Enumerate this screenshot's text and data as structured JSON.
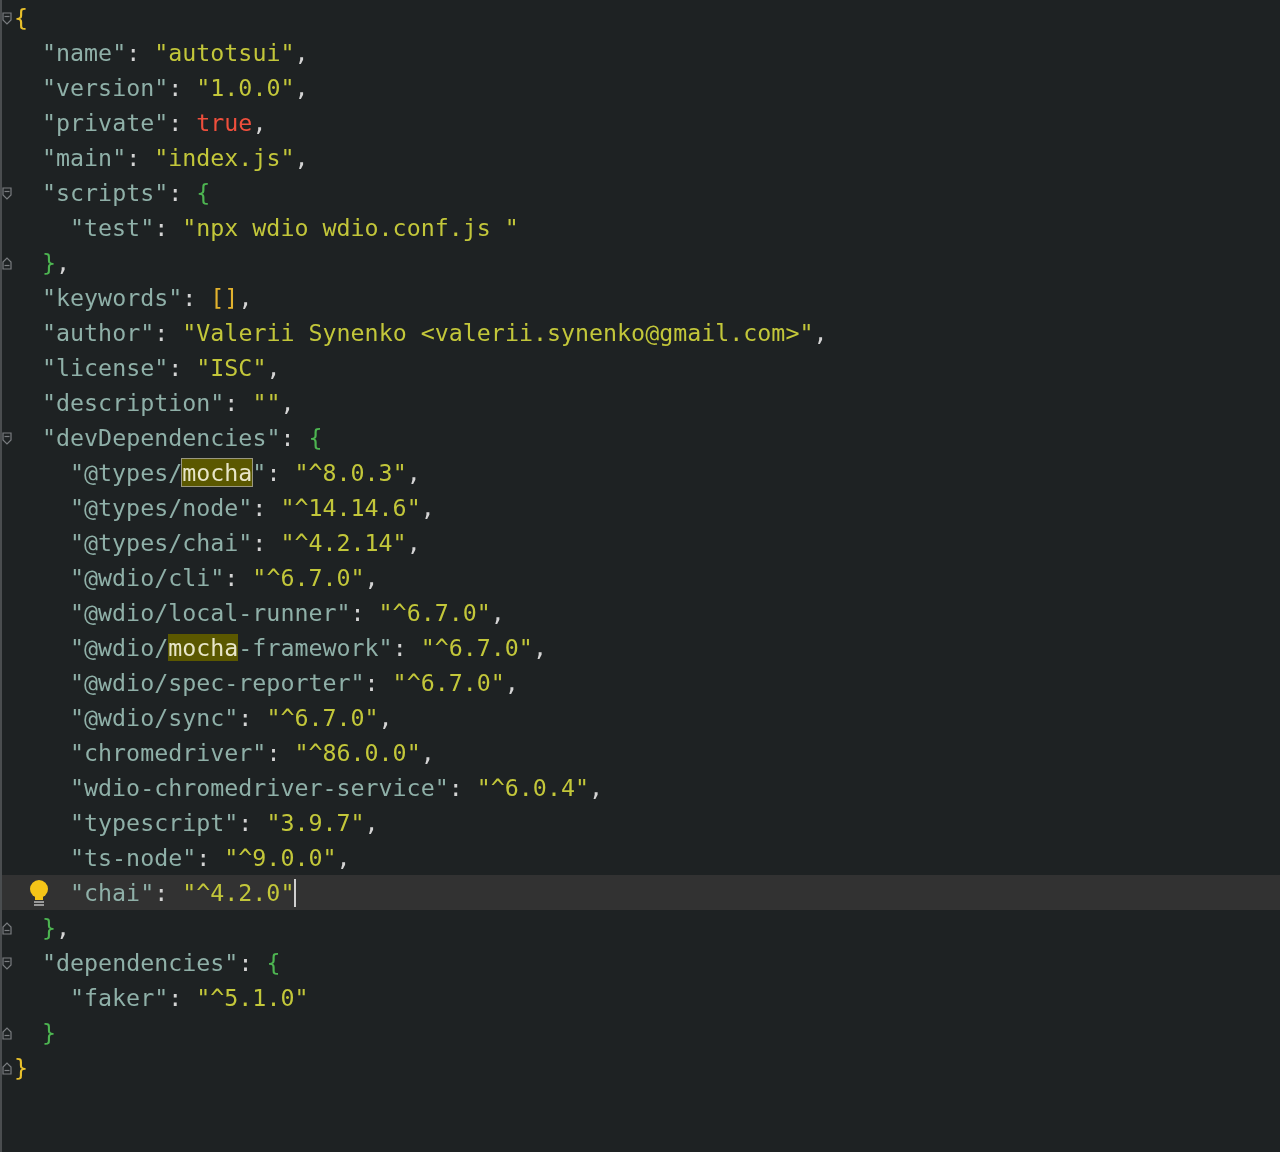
{
  "editor": {
    "lines": [
      {
        "kind": "open",
        "current": false,
        "tokens": [
          {
            "kind": "outer-brace",
            "text": "{"
          }
        ],
        "children": [
          {
            "current": false,
            "tokens": [
              {
                "kind": "key",
                "text": "\"name\""
              },
              {
                "kind": "punct",
                "text": ": "
              },
              {
                "kind": "string",
                "text": "\"autotsui\""
              },
              {
                "kind": "punct",
                "text": ","
              }
            ]
          },
          {
            "current": false,
            "tokens": [
              {
                "kind": "key",
                "text": "\"version\""
              },
              {
                "kind": "punct",
                "text": ": "
              },
              {
                "kind": "string",
                "text": "\"1.0.0\""
              },
              {
                "kind": "punct",
                "text": ","
              }
            ]
          },
          {
            "current": false,
            "tokens": [
              {
                "kind": "key",
                "text": "\"private\""
              },
              {
                "kind": "punct",
                "text": ": "
              },
              {
                "kind": "bool",
                "text": "true"
              },
              {
                "kind": "punct",
                "text": ","
              }
            ]
          },
          {
            "current": false,
            "tokens": [
              {
                "kind": "key",
                "text": "\"main\""
              },
              {
                "kind": "punct",
                "text": ": "
              },
              {
                "kind": "string",
                "text": "\"index.js\""
              },
              {
                "kind": "punct",
                "text": ","
              }
            ]
          },
          {
            "kind": "open",
            "current": false,
            "tokens": [
              {
                "kind": "key",
                "text": "\"scripts\""
              },
              {
                "kind": "punct",
                "text": ": "
              },
              {
                "kind": "inner-brace",
                "text": "{"
              }
            ],
            "children": [
              {
                "current": false,
                "tokens": [
                  {
                    "kind": "key",
                    "text": "\"test\""
                  },
                  {
                    "kind": "punct",
                    "text": ": "
                  },
                  {
                    "kind": "string",
                    "text": "\"npx wdio wdio.conf.js \""
                  }
                ]
              }
            ]
          },
          {
            "kind": "close",
            "current": false,
            "tokens": [
              {
                "kind": "inner-brace",
                "text": "}"
              },
              {
                "kind": "punct",
                "text": ","
              }
            ]
          },
          {
            "current": false,
            "tokens": [
              {
                "kind": "key",
                "text": "\"keywords\""
              },
              {
                "kind": "punct",
                "text": ": "
              },
              {
                "kind": "bracket",
                "text": "[]"
              },
              {
                "kind": "punct",
                "text": ","
              }
            ]
          },
          {
            "current": false,
            "tokens": [
              {
                "kind": "key",
                "text": "\"author\""
              },
              {
                "kind": "punct",
                "text": ": "
              },
              {
                "kind": "string",
                "text": "\"Valerii Synenko <valerii.synenko@gmail.com>\""
              },
              {
                "kind": "punct",
                "text": ","
              }
            ]
          },
          {
            "current": false,
            "tokens": [
              {
                "kind": "key",
                "text": "\"license\""
              },
              {
                "kind": "punct",
                "text": ": "
              },
              {
                "kind": "string",
                "text": "\"ISC\""
              },
              {
                "kind": "punct",
                "text": ","
              }
            ]
          },
          {
            "current": false,
            "tokens": [
              {
                "kind": "key",
                "text": "\"description\""
              },
              {
                "kind": "punct",
                "text": ": "
              },
              {
                "kind": "string",
                "text": "\"\""
              },
              {
                "kind": "punct",
                "text": ","
              }
            ]
          },
          {
            "kind": "open",
            "current": false,
            "tokens": [
              {
                "kind": "key",
                "text": "\"devDependencies\""
              },
              {
                "kind": "punct",
                "text": ": "
              },
              {
                "kind": "inner-brace",
                "text": "{"
              }
            ],
            "children": [
              {
                "current": false,
                "tokens": [
                  {
                    "kind": "key",
                    "text": "\"@types/"
                  },
                  {
                    "kind": "search-match",
                    "text": "mocha",
                    "selected": true
                  },
                  {
                    "kind": "key",
                    "text": "\""
                  },
                  {
                    "kind": "punct",
                    "text": ": "
                  },
                  {
                    "kind": "string",
                    "text": "\"^8.0.3\""
                  },
                  {
                    "kind": "punct",
                    "text": ","
                  }
                ]
              },
              {
                "current": false,
                "tokens": [
                  {
                    "kind": "key",
                    "text": "\"@types/node\""
                  },
                  {
                    "kind": "punct",
                    "text": ": "
                  },
                  {
                    "kind": "string",
                    "text": "\"^14.14.6\""
                  },
                  {
                    "kind": "punct",
                    "text": ","
                  }
                ]
              },
              {
                "current": false,
                "tokens": [
                  {
                    "kind": "key",
                    "text": "\"@types/chai\""
                  },
                  {
                    "kind": "punct",
                    "text": ": "
                  },
                  {
                    "kind": "string",
                    "text": "\"^4.2.14\""
                  },
                  {
                    "kind": "punct",
                    "text": ","
                  }
                ]
              },
              {
                "current": false,
                "tokens": [
                  {
                    "kind": "key",
                    "text": "\"@wdio/cli\""
                  },
                  {
                    "kind": "punct",
                    "text": ": "
                  },
                  {
                    "kind": "string",
                    "text": "\"^6.7.0\""
                  },
                  {
                    "kind": "punct",
                    "text": ","
                  }
                ]
              },
              {
                "current": false,
                "tokens": [
                  {
                    "kind": "key",
                    "text": "\"@wdio/local-runner\""
                  },
                  {
                    "kind": "punct",
                    "text": ": "
                  },
                  {
                    "kind": "string",
                    "text": "\"^6.7.0\""
                  },
                  {
                    "kind": "punct",
                    "text": ","
                  }
                ]
              },
              {
                "current": false,
                "tokens": [
                  {
                    "kind": "key",
                    "text": "\"@wdio/"
                  },
                  {
                    "kind": "search-match",
                    "text": "mocha",
                    "selected": false
                  },
                  {
                    "kind": "key",
                    "text": "-framework\""
                  },
                  {
                    "kind": "punct",
                    "text": ": "
                  },
                  {
                    "kind": "string",
                    "text": "\"^6.7.0\""
                  },
                  {
                    "kind": "punct",
                    "text": ","
                  }
                ]
              },
              {
                "current": false,
                "tokens": [
                  {
                    "kind": "key",
                    "text": "\"@wdio/spec-reporter\""
                  },
                  {
                    "kind": "punct",
                    "text": ": "
                  },
                  {
                    "kind": "string",
                    "text": "\"^6.7.0\""
                  },
                  {
                    "kind": "punct",
                    "text": ","
                  }
                ]
              },
              {
                "current": false,
                "tokens": [
                  {
                    "kind": "key",
                    "text": "\"@wdio/sync\""
                  },
                  {
                    "kind": "punct",
                    "text": ": "
                  },
                  {
                    "kind": "string",
                    "text": "\"^6.7.0\""
                  },
                  {
                    "kind": "punct",
                    "text": ","
                  }
                ]
              },
              {
                "current": false,
                "tokens": [
                  {
                    "kind": "key",
                    "text": "\"chromedriver\""
                  },
                  {
                    "kind": "punct",
                    "text": ": "
                  },
                  {
                    "kind": "string",
                    "text": "\"^86.0.0\""
                  },
                  {
                    "kind": "punct",
                    "text": ","
                  }
                ]
              },
              {
                "current": false,
                "tokens": [
                  {
                    "kind": "key",
                    "text": "\"wdio-chromedriver-service\""
                  },
                  {
                    "kind": "punct",
                    "text": ": "
                  },
                  {
                    "kind": "string",
                    "text": "\"^6.0.4\""
                  },
                  {
                    "kind": "punct",
                    "text": ","
                  }
                ]
              },
              {
                "current": false,
                "tokens": [
                  {
                    "kind": "key",
                    "text": "\"typescript\""
                  },
                  {
                    "kind": "punct",
                    "text": ": "
                  },
                  {
                    "kind": "string",
                    "text": "\"3.9.7\""
                  },
                  {
                    "kind": "punct",
                    "text": ","
                  }
                ]
              },
              {
                "current": false,
                "tokens": [
                  {
                    "kind": "key",
                    "text": "\"ts-node\""
                  },
                  {
                    "kind": "punct",
                    "text": ": "
                  },
                  {
                    "kind": "string",
                    "text": "\"^9.0.0\""
                  },
                  {
                    "kind": "punct",
                    "text": ","
                  }
                ]
              },
              {
                "current": true,
                "tokens": [
                  {
                    "kind": "key",
                    "text": "\"chai\""
                  },
                  {
                    "kind": "punct",
                    "text": ": "
                  },
                  {
                    "kind": "string",
                    "text": "\"^4.2.0\""
                  }
                ]
              }
            ]
          },
          {
            "kind": "close",
            "current": false,
            "tokens": [
              {
                "kind": "inner-brace",
                "text": "}"
              },
              {
                "kind": "punct",
                "text": ","
              }
            ]
          },
          {
            "kind": "open",
            "current": false,
            "tokens": [
              {
                "kind": "key",
                "text": "\"dependencies\""
              },
              {
                "kind": "punct",
                "text": ": "
              },
              {
                "kind": "inner-brace",
                "text": "{"
              }
            ],
            "children": [
              {
                "current": false,
                "tokens": [
                  {
                    "kind": "key",
                    "text": "\"faker\""
                  },
                  {
                    "kind": "punct",
                    "text": ": "
                  },
                  {
                    "kind": "string",
                    "text": "\"^5.1.0\""
                  }
                ]
              }
            ]
          },
          {
            "kind": "close",
            "current": false,
            "tokens": [
              {
                "kind": "inner-brace",
                "text": "}"
              }
            ]
          }
        ]
      },
      {
        "kind": "close",
        "current": false,
        "tokens": [
          {
            "kind": "outer-brace",
            "text": "}"
          }
        ]
      }
    ]
  }
}
